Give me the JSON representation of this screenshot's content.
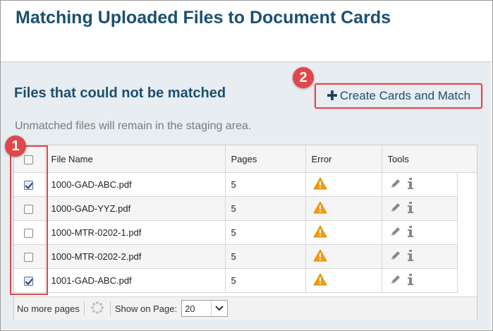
{
  "page": {
    "title": "Matching Uploaded Files to Document Cards"
  },
  "section": {
    "title": "Files that could not be matched",
    "subtitle": "Unmatched files will remain in the staging area.",
    "create_button_label": "Create Cards and Match"
  },
  "table": {
    "columns": {
      "file_name": "File Name",
      "pages": "Pages",
      "error": "Error",
      "tools": "Tools"
    },
    "rows": [
      {
        "checked": true,
        "file_name": "1000-GAD-ABC.pdf",
        "pages": "5"
      },
      {
        "checked": false,
        "file_name": "1000-GAD-YYZ.pdf",
        "pages": "5"
      },
      {
        "checked": false,
        "file_name": "1000-MTR-0202-1.pdf",
        "pages": "5"
      },
      {
        "checked": false,
        "file_name": "1000-MTR-0202-2.pdf",
        "pages": "5"
      },
      {
        "checked": true,
        "file_name": "1001-GAD-ABC.pdf",
        "pages": "5"
      }
    ]
  },
  "footer": {
    "no_more_pages": "No more pages",
    "show_on_page_label": "Show on Page:",
    "page_size_value": "20"
  },
  "callouts": {
    "one": "1",
    "two": "2"
  },
  "colors": {
    "title": "#1b4f72",
    "panel_bg": "#e8edf1",
    "callout_red": "#e0474c",
    "warning_orange": "#f39c12"
  },
  "icons": {
    "plus": "plus-icon",
    "warning": "warning-icon",
    "edit": "pencil-icon",
    "info": "info-icon",
    "spinner": "loading-spinner-icon",
    "dropdown": "chevron-down-icon"
  }
}
